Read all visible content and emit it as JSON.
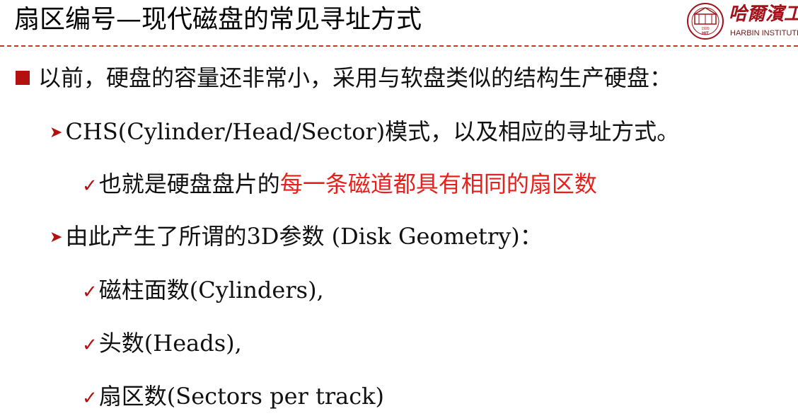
{
  "title": "扇区编号—现代磁盘的常见寻址方式",
  "logo": {
    "cn": "哈爾濱工",
    "en": "HARBIN INSTITUTE",
    "seal_text": "HIT",
    "seal_year": "1920"
  },
  "colors": {
    "accent_red": "#b31010",
    "highlight_red": "#e8201c",
    "divider": "#c0392b"
  },
  "icons": {
    "level1": "square-bullet",
    "level2": "arrow-bullet",
    "level3": "check-bullet"
  },
  "content": {
    "l1": "以前，硬盘的容量还非常小，采用与软盘类似的结构生产硬盘：",
    "l2a": "CHS(Cylinder/Head/Sector)模式，以及相应的寻址方式。",
    "l3a_pre": "也就是硬盘盘片的",
    "l3a_red": "每一条磁道都具有相同的扇区数",
    "l2b": "由此产生了所谓的3D参数 (Disk Geometry)：",
    "l3b": "磁柱面数(Cylinders),",
    "l3c": "头数(Heads),",
    "l3d": "扇区数(Sectors per track)"
  }
}
